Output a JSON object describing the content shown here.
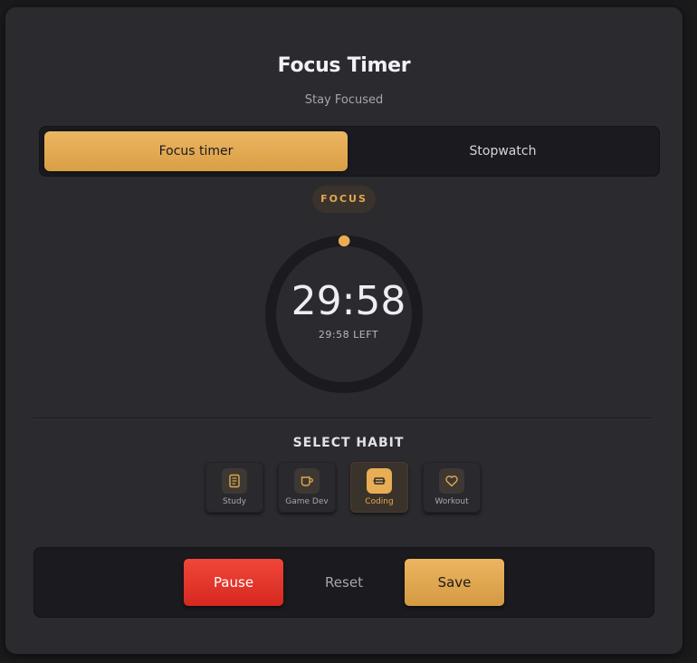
{
  "header": {
    "title": "Focus Timer",
    "subtitle": "Stay Focused"
  },
  "tabs": [
    {
      "label": "Focus timer",
      "active": true
    },
    {
      "label": "Stopwatch",
      "active": false
    }
  ],
  "mode_badge": "FOCUS",
  "timer": {
    "display": "29:58",
    "remaining_label": "29:58 LEFT",
    "progress_fraction": 0.001
  },
  "habits": {
    "section_title": "SELECT HABIT",
    "items": [
      {
        "label": "Study",
        "icon": "book-icon",
        "active": false
      },
      {
        "label": "Game Dev",
        "icon": "coffee-icon",
        "active": false
      },
      {
        "label": "Coding",
        "icon": "code-icon",
        "active": true
      },
      {
        "label": "Workout",
        "icon": "heart-icon",
        "active": false
      }
    ]
  },
  "controls": {
    "pause_label": "Pause",
    "reset_label": "Reset",
    "save_label": "Save"
  },
  "colors": {
    "accent": "#e8ad55",
    "danger": "#e03a2f",
    "background": "#2b2a2f"
  }
}
